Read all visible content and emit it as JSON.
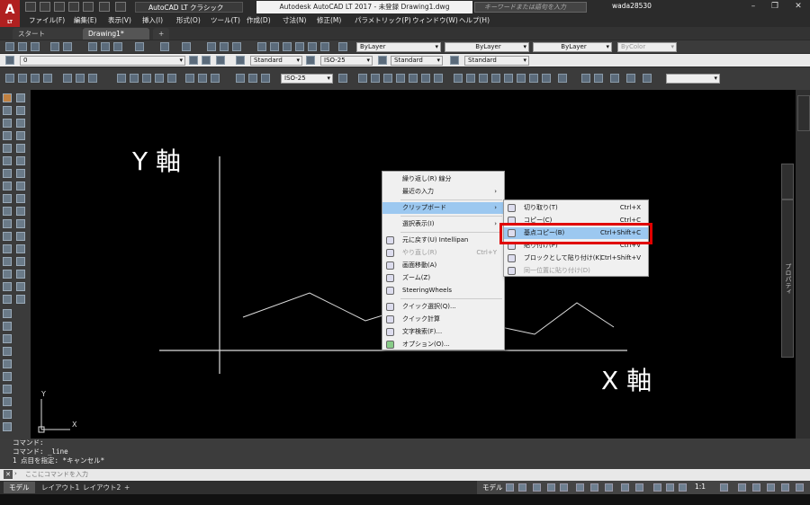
{
  "app": {
    "logo_text": "A",
    "logo_sub": "LT",
    "workspace": "AutoCAD LT クラシック",
    "title": "Autodesk AutoCAD LT 2017 - 未登録    Drawing1.dwg",
    "search_placeholder": "キーワードまたは語句を入力",
    "user": "wada28530"
  },
  "menubar": [
    "ファイル(F)",
    "編集(E)",
    "表示(V)",
    "挿入(I)",
    "形式(O)",
    "ツール(T)",
    "作成(D)",
    "寸法(N)",
    "修正(M)",
    "パラメトリック(P)",
    "ウィンドウ(W)",
    "ヘルプ(H)"
  ],
  "tabs": {
    "start": "スタート",
    "drawing": "Drawing1*"
  },
  "toolbar": {
    "bylayer_color": "ByLayer",
    "bylayer_linetype": "ByLayer",
    "bylayer_lineweight": "ByLayer",
    "bycolor": "ByColor",
    "layer": "0",
    "text_style": "Standard",
    "dim_style": "ISO-25",
    "table_style": "Standard",
    "mleader_style": "Standard",
    "dim_style2": "ISO-25"
  },
  "canvas": {
    "y_label": "Y 軸",
    "x_label": "X 軸",
    "ucs_x": "X",
    "ucs_y": "Y"
  },
  "context_menu": {
    "items": [
      {
        "label": "繰り返し(R) 線分",
        "shortcut": ""
      },
      {
        "label": "最近の入力",
        "shortcut": "›"
      },
      {
        "label": "クリップボード",
        "shortcut": "›"
      },
      {
        "label": "選択表示(I)",
        "shortcut": "›"
      },
      {
        "label": "元に戻す(U) Intellipan",
        "shortcut": ""
      },
      {
        "label": "やり直し(R)",
        "shortcut": "Ctrl+Y"
      },
      {
        "label": "画面移動(A)",
        "shortcut": ""
      },
      {
        "label": "ズーム(Z)",
        "shortcut": ""
      },
      {
        "label": "SteeringWheels",
        "shortcut": ""
      },
      {
        "label": "クイック選択(Q)...",
        "shortcut": ""
      },
      {
        "label": "クイック計算",
        "shortcut": ""
      },
      {
        "label": "文字検索(F)...",
        "shortcut": ""
      },
      {
        "label": "オプション(O)...",
        "shortcut": ""
      }
    ]
  },
  "submenu": {
    "items": [
      {
        "label": "切り取り(T)",
        "shortcut": "Ctrl+X"
      },
      {
        "label": "コピー(C)",
        "shortcut": "Ctrl+C"
      },
      {
        "label": "基点コピー(B)",
        "shortcut": "Ctrl+Shift+C"
      },
      {
        "label": "貼り付け(P)",
        "shortcut": "Ctrl+V"
      },
      {
        "label": "ブロックとして貼り付け(K)",
        "shortcut": "Ctrl+Shift+V"
      },
      {
        "label": "同一位置に貼り付け(D)",
        "shortcut": ""
      }
    ]
  },
  "command": {
    "history": [
      "コマンド:",
      "コマンド: _line",
      "1 点目を指定: *キャンセル*"
    ],
    "placeholder": "ここにコマンドを入力"
  },
  "layout_tabs": [
    "モデル",
    "レイアウト1",
    "レイアウト2"
  ],
  "status": {
    "model": "モデル",
    "scale": "1:1"
  },
  "right_panel_label": "プロパティ"
}
